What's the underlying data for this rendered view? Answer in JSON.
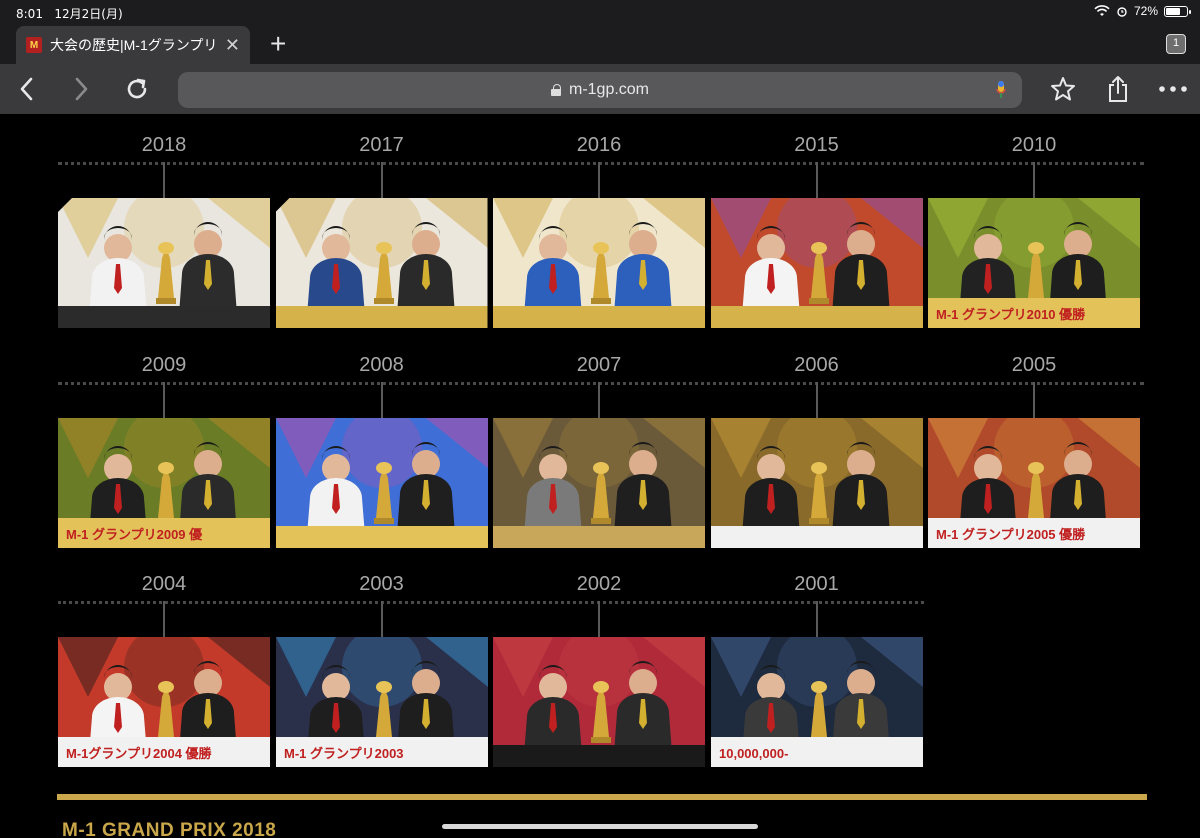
{
  "status": {
    "time": "8:01",
    "date": "12月2日(月)",
    "battery": "72%",
    "battery_level": 0.72
  },
  "tab": {
    "title": "大会の歴史|M-1グランプリ",
    "favicon": "M",
    "count": "1"
  },
  "address": {
    "url": "m-1gp.com"
  },
  "timeline": [
    {
      "year": "2018",
      "bg": "#e9e6e0",
      "floor": "#2b2b2b",
      "accent": "#d8b348",
      "suit1": "#f2f2f2",
      "suit2": "#2c2c2c",
      "caption": ""
    },
    {
      "year": "2017",
      "bg": "#ece7dc",
      "floor": "#d6b34a",
      "accent": "#c9a037",
      "suit1": "#284a8c",
      "suit2": "#2a2a2a",
      "caption": ""
    },
    {
      "year": "2016",
      "bg": "#efe6cc",
      "floor": "#d6b34a",
      "accent": "#c9a037",
      "suit1": "#2d5fbd",
      "suit2": "#2d5fbd",
      "caption": ""
    },
    {
      "year": "2015",
      "bg": "#c14a2c",
      "floor": "#d6b34a",
      "accent": "#7a4fc4",
      "suit1": "#f4f4f4",
      "suit2": "#1f1f1f",
      "caption": ""
    },
    {
      "year": "2010",
      "bg": "#7a8f2c",
      "floor": "#e3c25a",
      "accent": "#a8c43a",
      "suit1": "#222222",
      "suit2": "#1e1e1e",
      "caption": "M-1 グランプリ2010 優勝"
    },
    {
      "year": "2009",
      "bg": "#6a7d26",
      "floor": "#e3c25a",
      "accent": "#c48a2a",
      "suit1": "#1f1f1f",
      "suit2": "#2a2a2a",
      "caption": "M-1 グランプリ2009 優"
    },
    {
      "year": "2008",
      "bg": "#3f6ed6",
      "floor": "#e3c25a",
      "accent": "#d04aa0",
      "suit1": "#f2f2f2",
      "suit2": "#1f1f1f",
      "caption": ""
    },
    {
      "year": "2007",
      "bg": "#6a5a3a",
      "floor": "#c9a75a",
      "accent": "#b08a3a",
      "suit1": "#7a7a7a",
      "suit2": "#1f1f1f",
      "caption": ""
    },
    {
      "year": "2006",
      "bg": "#8a6a2a",
      "floor": "#f1f1f1",
      "accent": "#c9a037",
      "suit1": "#1e1e1e",
      "suit2": "#1e1e1e",
      "caption": ""
    },
    {
      "year": "2005",
      "bg": "#b04a2a",
      "floor": "#f1f1f1",
      "accent": "#e0a040",
      "suit1": "#1e1e1e",
      "suit2": "#1e1e1e",
      "caption": "M-1 グランプリ2005 優勝"
    },
    {
      "year": "2004",
      "bg": "#c43a2a",
      "floor": "#f1f1f1",
      "accent": "#1a1a1a",
      "suit1": "#f4f4f4",
      "suit2": "#1e1e1e",
      "caption": "M-1グランプリ2004 優勝"
    },
    {
      "year": "2003",
      "bg": "#2a2f4a",
      "floor": "#f1f1f1",
      "accent": "#3aa0e0",
      "suit1": "#1e1e1e",
      "suit2": "#1e1e1e",
      "caption": "M-1 グランプリ2003"
    },
    {
      "year": "2002",
      "bg": "#b02a3a",
      "floor": "#1a1a1a",
      "accent": "#d04a4a",
      "suit1": "#2a2a2a",
      "suit2": "#2a2a2a",
      "caption": ""
    },
    {
      "year": "2001",
      "bg": "#1e2a3e",
      "floor": "#f1f1f1",
      "accent": "#4a6aa0",
      "suit1": "#3a3a3a",
      "suit2": "#3a3a3a",
      "caption": "10,000,000-"
    }
  ],
  "footer": {
    "section_title": "M-1 GRAND PRIX 2018"
  },
  "icons": {
    "back": "chevron-left-icon",
    "forward": "chevron-right-icon",
    "reload": "reload-icon",
    "bookmark": "star-icon",
    "share": "share-icon",
    "more": "more-icon",
    "mic": "mic-icon"
  }
}
